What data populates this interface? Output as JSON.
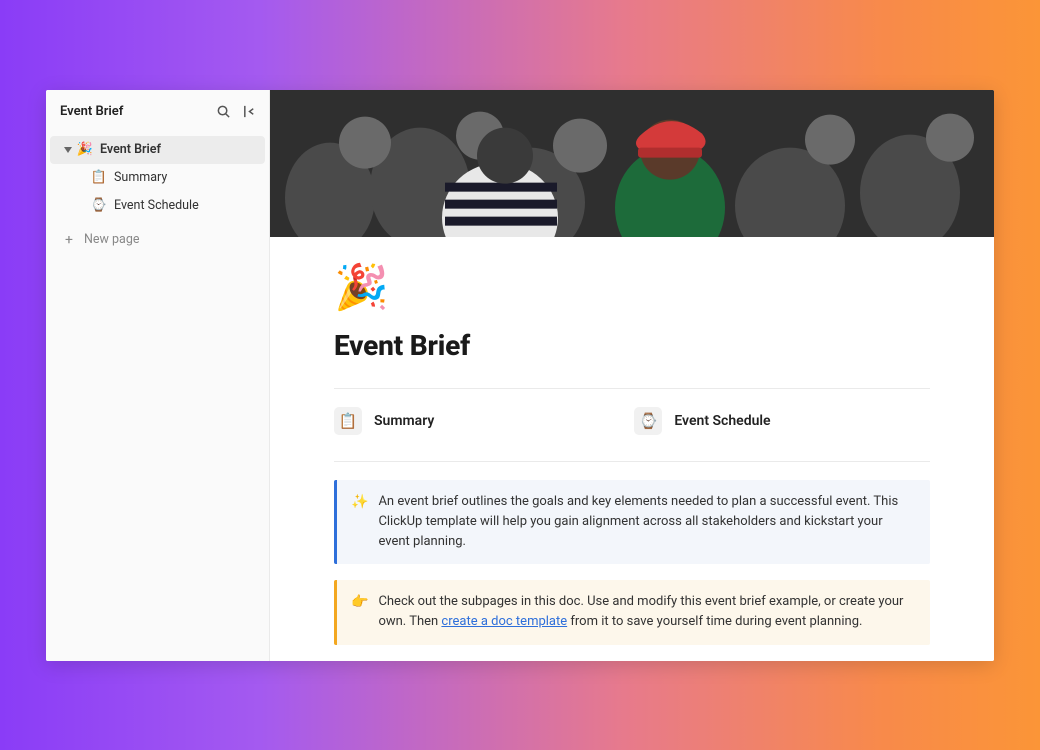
{
  "sidebar": {
    "title": "Event Brief",
    "items": [
      {
        "icon": "🎉",
        "label": "Event Brief"
      },
      {
        "icon": "📋",
        "label": "Summary"
      },
      {
        "icon": "⌚",
        "label": "Event Schedule"
      }
    ],
    "new_page": "New page"
  },
  "page": {
    "emoji": "🎉",
    "title": "Event Brief",
    "subpages": [
      {
        "icon": "📋",
        "label": "Summary"
      },
      {
        "icon": "⌚",
        "label": "Event Schedule"
      }
    ],
    "callout_blue": {
      "emoji": "✨",
      "text": "An event brief outlines the goals and key elements needed to plan a successful event. This ClickUp template will help you gain alignment across all stakeholders and kickstart your event planning."
    },
    "callout_orange": {
      "emoji": "👉",
      "text_before": "Check out the subpages in this doc. Use and modify this event brief example, or create your own. Then ",
      "link": "create a doc template",
      "text_after": " from it to save yourself time during event planning."
    }
  }
}
